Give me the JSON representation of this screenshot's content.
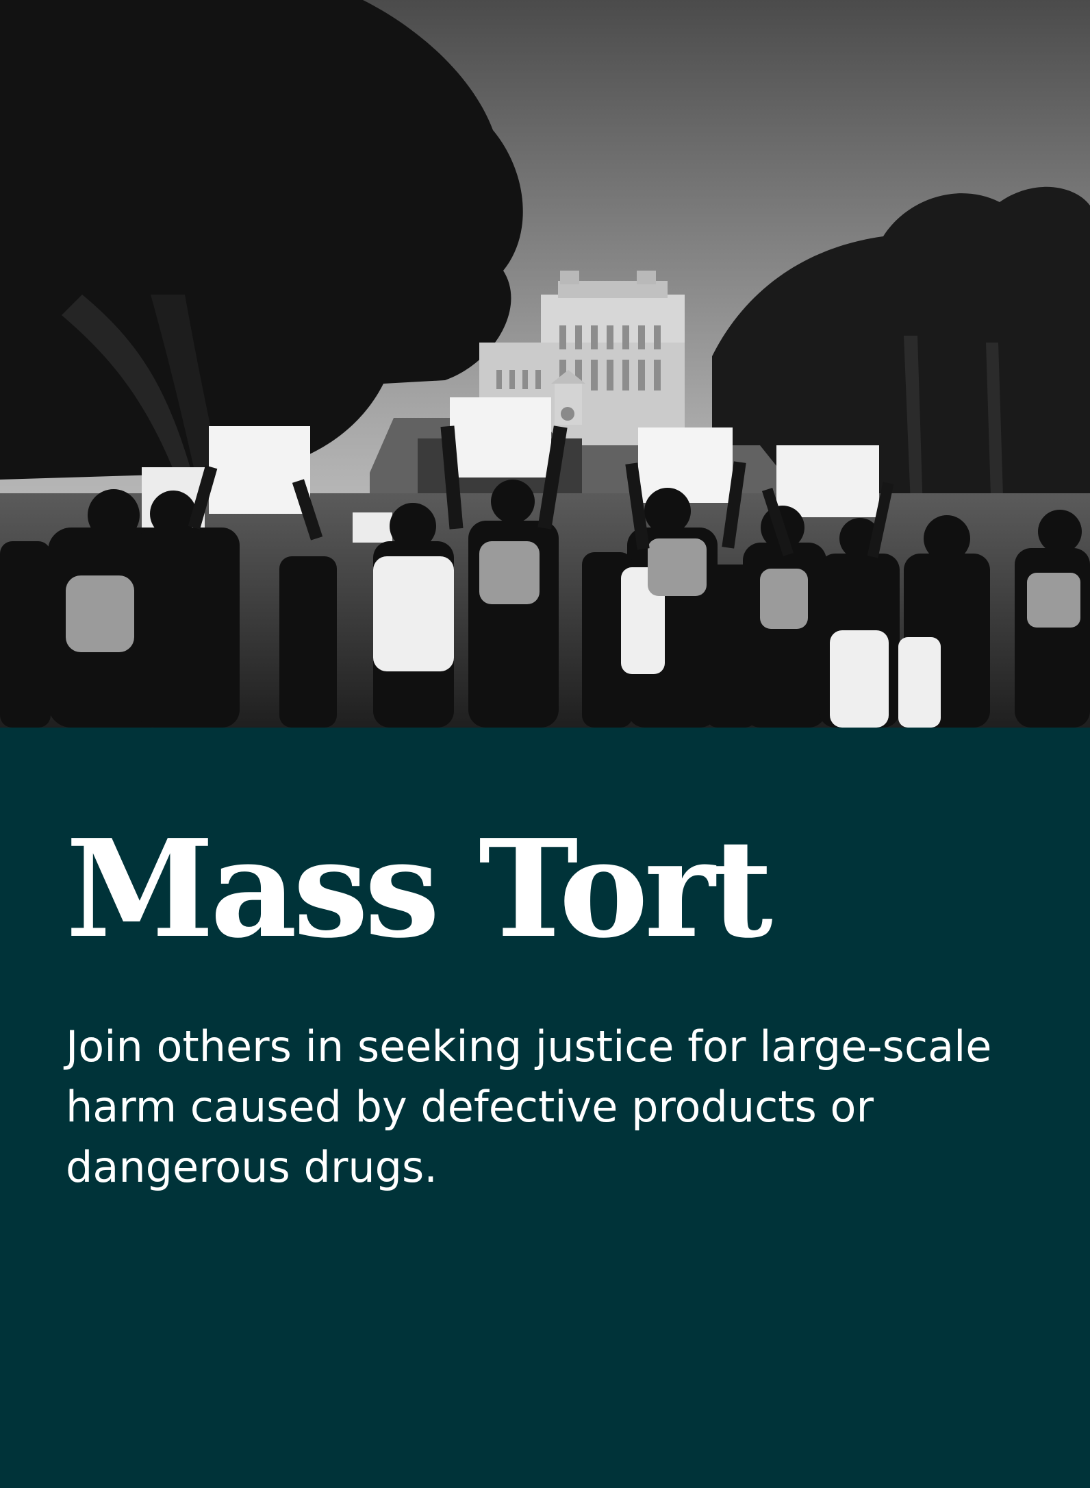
{
  "hero": {
    "image": "black-and-white protest crowd holding signs in front of a building",
    "colors": {
      "sky_top": "#4f4f4f",
      "sky_bottom": "#d9d9d9",
      "foliage": "#161616",
      "building": "#d7d7d7",
      "crowd": "#101010",
      "sign": "#f1f1f1"
    }
  },
  "main": {
    "title": "Mass Tort",
    "description": "Join others in seeking justice for large-scale harm caused by defective products or dangerous drugs."
  },
  "theme": {
    "panel_background": "#003339",
    "text_color": "#ffffff"
  }
}
